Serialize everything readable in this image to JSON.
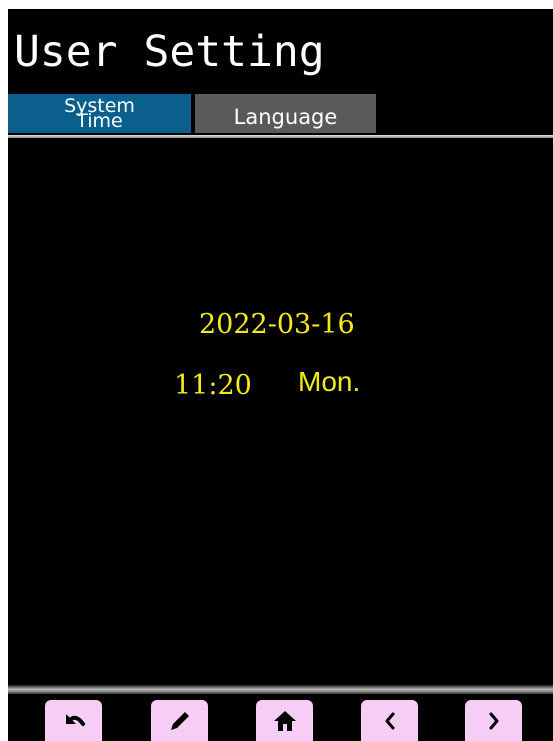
{
  "header": {
    "title": "User Setting"
  },
  "tabs": {
    "system_time": "System Time",
    "language": "Language"
  },
  "clock": {
    "date": "2022-03-16",
    "time": "11:20",
    "day": "Mon."
  },
  "nav": {
    "buttons": [
      "back-icon",
      "edit-icon",
      "home-icon",
      "chevron-left-icon",
      "chevron-right-icon"
    ]
  },
  "colors": {
    "background": "#000000",
    "active_tab": "#0b5f8c",
    "inactive_tab": "#5a5a5a",
    "clock_text": "#f2ea1a",
    "nav_button": "#f5cdf5"
  }
}
